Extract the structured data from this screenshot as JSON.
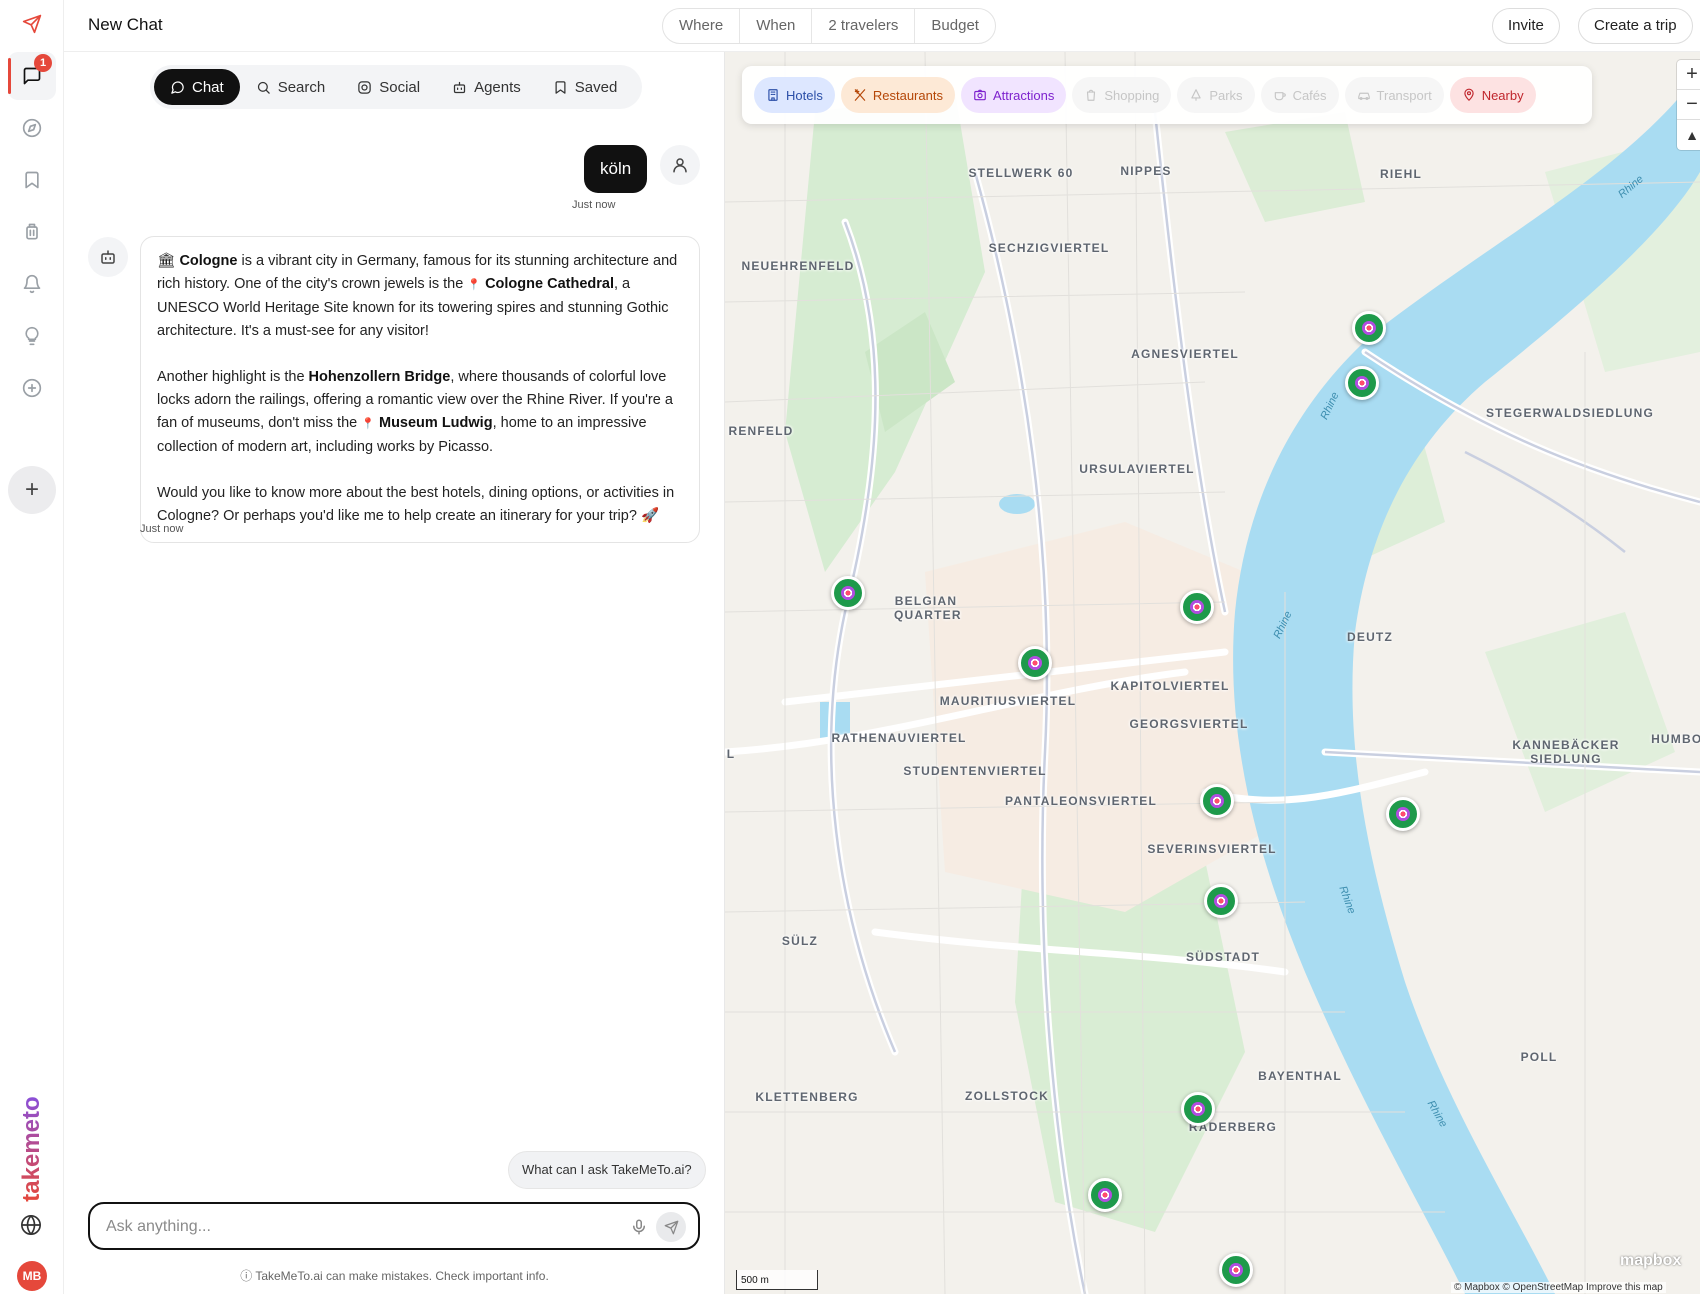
{
  "rail": {
    "items": [
      {
        "icon": "send-icon"
      },
      {
        "icon": "chat-icon",
        "badge": "1"
      },
      {
        "icon": "compass-icon"
      },
      {
        "icon": "bookmark-icon"
      },
      {
        "icon": "luggage-icon"
      },
      {
        "icon": "bell-icon"
      },
      {
        "icon": "lightbulb-icon"
      },
      {
        "icon": "plus-circle-icon"
      }
    ],
    "new_label": "+",
    "brand": "takemeto",
    "avatar_initials": "MB"
  },
  "header": {
    "title": "New Chat",
    "filters": [
      "Where",
      "When",
      "2 travelers",
      "Budget"
    ],
    "invite_label": "Invite",
    "create_trip_label": "Create a trip"
  },
  "chat": {
    "tabs": [
      {
        "label": "Chat",
        "icon": "message-icon",
        "active": true
      },
      {
        "label": "Search",
        "icon": "search-icon"
      },
      {
        "label": "Social",
        "icon": "instagram-icon"
      },
      {
        "label": "Agents",
        "icon": "robot-icon"
      },
      {
        "label": "Saved",
        "icon": "bookmark-icon"
      }
    ],
    "user_message": "köln",
    "user_time": "Just now",
    "bot_time": "Just now",
    "bot_message": {
      "p1": {
        "pre_emoji": "🏛",
        "b1": "Cologne",
        "t1": " is a vibrant city in Germany, famous for its stunning architecture and rich history. One of the city's crown jewels is the ",
        "pin1": "📍",
        "b2": "Cologne Cathedral",
        "t2": ", a UNESCO World Heritage Site known for its towering spires and stunning Gothic architecture. It's a must-see for any visitor!"
      },
      "p2": {
        "t1": "Another highlight is the ",
        "b1": "Hohenzollern Bridge",
        "t2": ", where thousands of colorful love locks adorn the railings, offering a romantic view over the Rhine River. If you're a fan of museums, don't miss the ",
        "pin1": "📍",
        "b2": "Museum Ludwig",
        "t3": ", home to an impressive collection of modern art, including works by Picasso."
      },
      "p3": {
        "t1": "Would you like to know more about the best hotels, dining options, or activities in Cologne? Or perhaps you'd like me to help create an itinerary for your trip? ",
        "emoji": "🚀"
      }
    },
    "suggestion": "What can I ask TakeMeTo.ai?",
    "input_placeholder": "Ask anything...",
    "disclaimer": "ⓘ TakeMeTo.ai can make mistakes. Check important info."
  },
  "map": {
    "categories": [
      {
        "label": "Hotels",
        "icon": "building-icon",
        "color": "#2b4fa8",
        "bg": "#dde7ff",
        "enabled": true
      },
      {
        "label": "Restaurants",
        "icon": "utensils-icon",
        "color": "#b54708",
        "bg": "#fde9d6",
        "enabled": true
      },
      {
        "label": "Attractions",
        "icon": "camera-icon",
        "color": "#7e22ce",
        "bg": "#f1e4ff",
        "enabled": true
      },
      {
        "label": "Shopping",
        "icon": "bag-icon",
        "enabled": false
      },
      {
        "label": "Parks",
        "icon": "tree-icon",
        "enabled": false
      },
      {
        "label": "Cafés",
        "icon": "cup-icon",
        "enabled": false
      },
      {
        "label": "Transport",
        "icon": "car-icon",
        "enabled": false
      },
      {
        "label": "Nearby",
        "icon": "map-pin-icon",
        "color": "#c0262d",
        "bg": "#fde2e2",
        "enabled": true
      }
    ],
    "districts": [
      "STELLWERK 60",
      "NIPPES",
      "RIEHL",
      "SECHZIGVIERTEL",
      "NEUEHRENFELD",
      "AGNESVIERTEL",
      "STEGERWALDSIEDLUNG",
      "RENFELD",
      "URSULAVIERTEL",
      "BELGIAN QUARTER",
      "DEUTZ",
      "KAPITOLVIERTEL",
      "MAURITIUSVIERTEL",
      "GEORGSVIERTEL",
      "RATHENAUVIERTEL",
      "KANNEBÄCKER SIEDLUNG",
      "HUMBOL",
      "STUDENTENVIERTEL",
      "PANTALEONSVIERTEL",
      "SEVERINSVIERTEL",
      "L",
      "SÜLZ",
      "SÜDSTADT",
      "POLL",
      "BAYENTHAL",
      "KLETTENBERG",
      "ZOLLSTOCK",
      "RADERBERG"
    ],
    "river_labels": [
      "Rhine",
      "Rhine",
      "Rhine",
      "Rhine",
      "Rhine"
    ],
    "pin_count": 13,
    "scale_label": "500 m",
    "attribution": "© Mapbox © OpenStreetMap  Improve this map",
    "logo": "mapbox",
    "zoom_in": "+",
    "zoom_out": "−",
    "compass": "▲"
  }
}
